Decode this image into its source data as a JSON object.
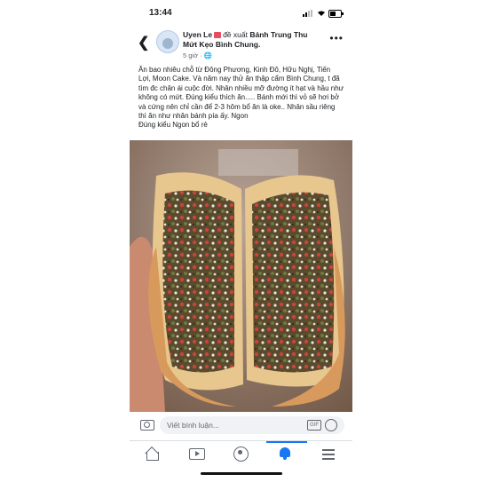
{
  "status_bar": {
    "time": "13:44"
  },
  "post": {
    "author": "Uyen Le",
    "action": "đề xuất",
    "page": "Bánh Trung Thu Mứt Kẹo Bình Chung.",
    "time": "5 giờ",
    "text": "Ăn bao nhiêu chỗ từ Đông Phương, Kinh Đô, Hữu Nghị, Tiến Lợi, Moon Cake. Và năm nay thử ăn thập cẩm Bình Chung, t đã tìm đc chân ái cuộc đời. Nhân nhiều mỡ đường ít hạt và hầu như không có mứt. Đúng kiểu thích ăn..... Bánh mới thì vỏ sẽ hơi bở và cứng nên chỉ cần để 2-3 hôm bổ ăn là oke.. Nhân sầu riêng thì ăn như nhân bánh pía ấy. Ngon\nĐúng kiểu Ngon bổ rẻ"
  },
  "comment": {
    "placeholder": "Viết bình luận...",
    "gif_label": "GIF"
  },
  "colors": {
    "accent": "#1877f2",
    "icon": "#606770"
  }
}
